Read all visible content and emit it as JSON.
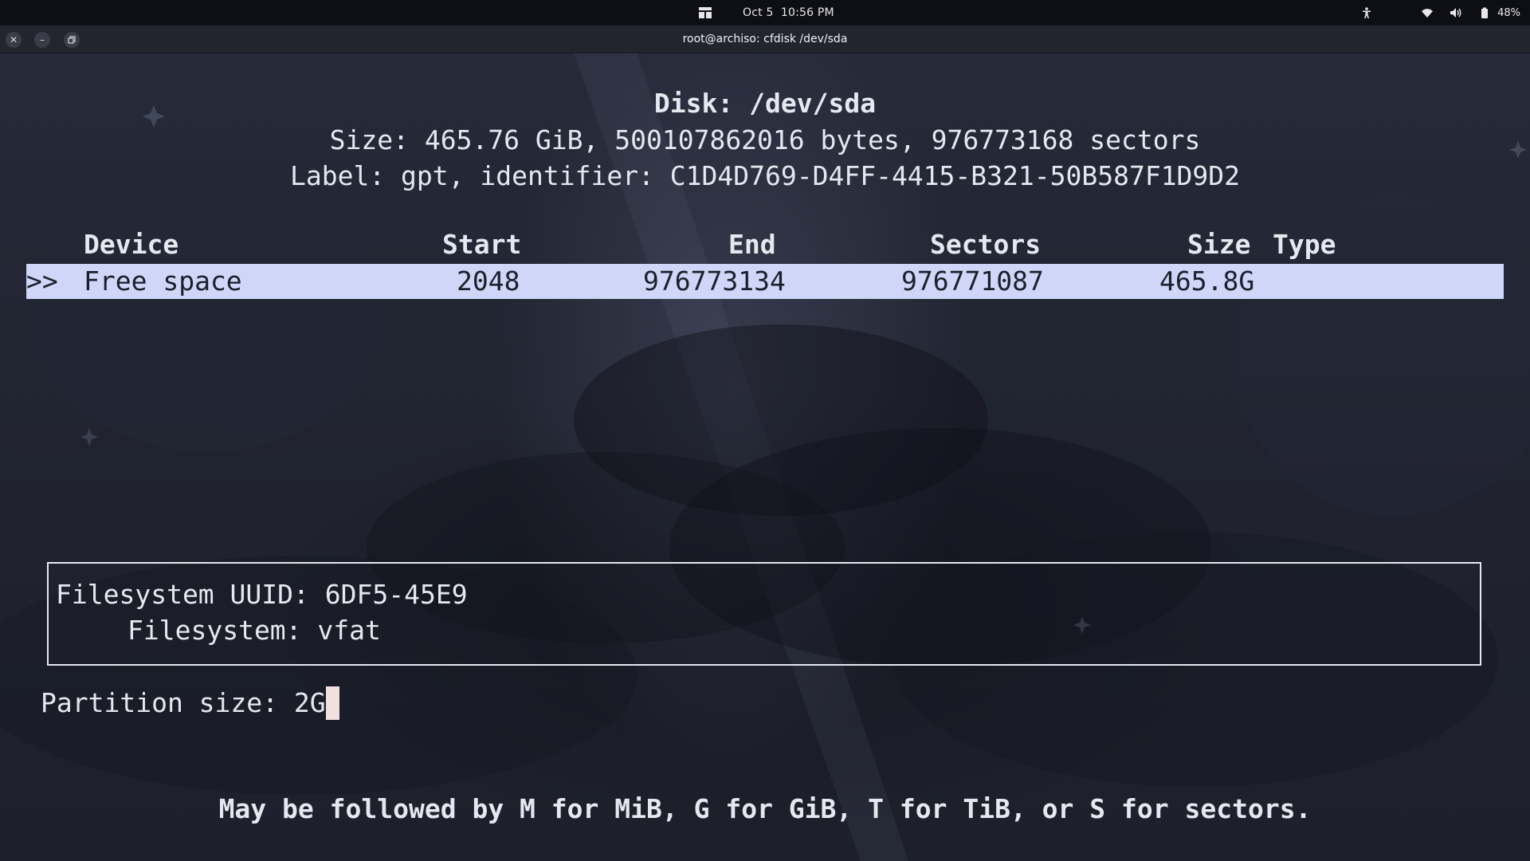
{
  "topbar": {
    "date": "Oct 5",
    "time": "10:56 PM",
    "battery_percent": "48%",
    "icons": [
      "activities-grid-icon",
      "accessibility-icon",
      "wifi-icon",
      "volume-icon",
      "battery-icon"
    ]
  },
  "window": {
    "title": "root@archiso: cfdisk /dev/sda",
    "buttons": [
      "close-icon",
      "minimize-icon",
      "restore-icon"
    ]
  },
  "cfdisk": {
    "disk_line": "Disk: /dev/sda",
    "size_line": "Size: 465.76 GiB, 500107862016 bytes, 976773168 sectors",
    "label_line": "Label: gpt, identifier: C1D4D769-D4FF-4415-B321-50B587F1D9D2",
    "columns": {
      "device": "Device",
      "start": "Start",
      "end": "End",
      "sectors": "Sectors",
      "size": "Size",
      "type": "Type"
    },
    "rows": [
      {
        "marker": ">>",
        "device": "Free space",
        "start": "2048",
        "end": "976773134",
        "sectors": "976771087",
        "size": "465.8G",
        "type": ""
      }
    ],
    "info": {
      "uuid_line": "Filesystem UUID: 6DF5-45E9",
      "fs_line": "Filesystem: vfat"
    },
    "prompt": {
      "label": "Partition size: ",
      "value": "2G"
    },
    "hint": "May be followed by M for MiB, G for GiB, T for TiB, or S for sectors."
  },
  "colors": {
    "selection_bg": "#cfd6f7",
    "terminal_fg": "#e6e8f0",
    "cursor": "#f3dfe0"
  }
}
